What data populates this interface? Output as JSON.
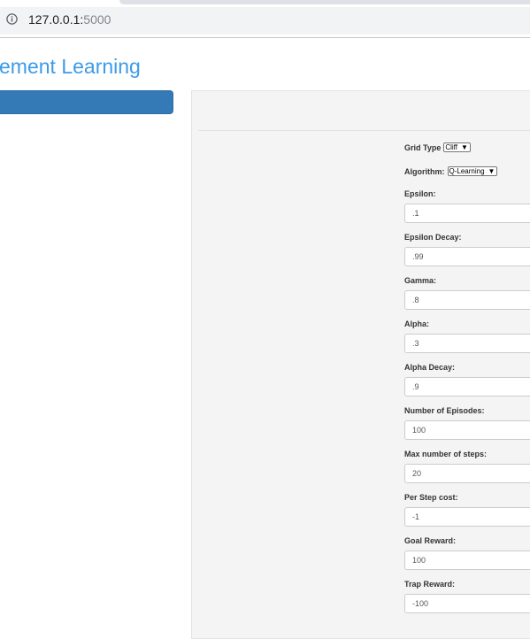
{
  "browser": {
    "url_host": "127.0.0.1:",
    "url_port": "5000",
    "info_icon": "info-icon"
  },
  "page": {
    "title": "ement Learning"
  },
  "form": {
    "grid_type": {
      "label": "Grid Type",
      "selected": "Cliff"
    },
    "algorithm": {
      "label": "Algorithm:",
      "selected": "Q-Learning"
    },
    "fields": [
      {
        "label": "Epsilon:",
        "value": ".1"
      },
      {
        "label": "Epsilon Decay:",
        "value": ".99"
      },
      {
        "label": "Gamma:",
        "value": ".8"
      },
      {
        "label": "Alpha:",
        "value": ".3"
      },
      {
        "label": "Alpha Decay:",
        "value": ".9"
      },
      {
        "label": "Number of Episodes:",
        "value": "100"
      },
      {
        "label": "Max number of steps:",
        "value": "20"
      },
      {
        "label": "Per Step cost:",
        "value": "-1"
      },
      {
        "label": "Goal Reward:",
        "value": "100"
      },
      {
        "label": "Trap Reward:",
        "value": "-100"
      }
    ]
  }
}
